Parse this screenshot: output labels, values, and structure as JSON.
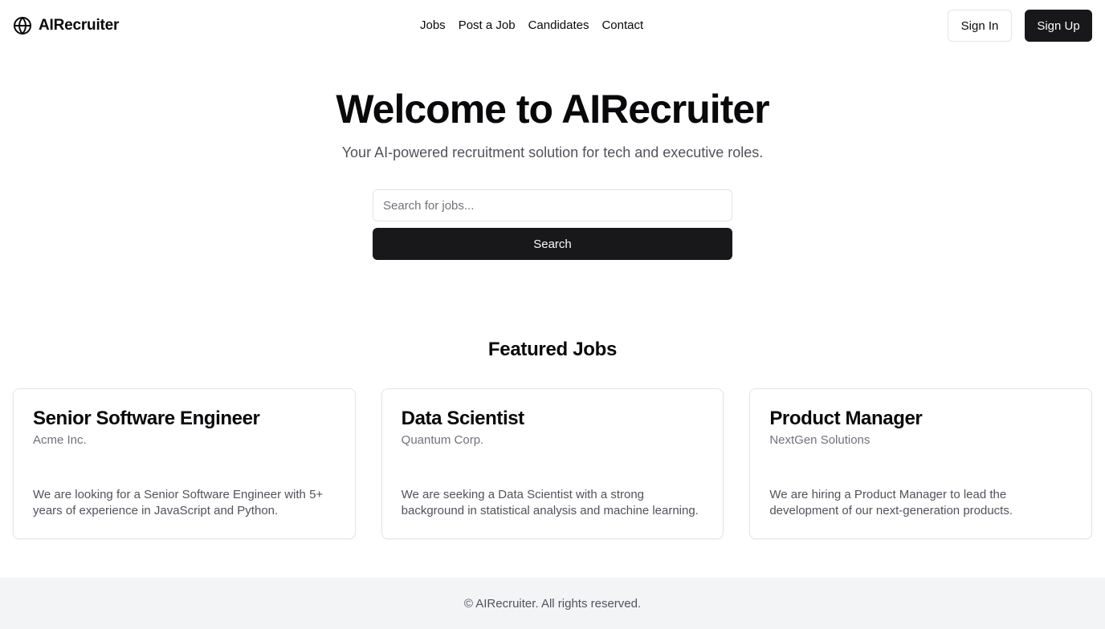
{
  "header": {
    "brand_name": "AIRecruiter",
    "brand_icon": "globe-icon",
    "nav": [
      {
        "label": "Jobs"
      },
      {
        "label": "Post a Job"
      },
      {
        "label": "Candidates"
      },
      {
        "label": "Contact"
      }
    ],
    "sign_in_label": "Sign In",
    "sign_up_label": "Sign Up"
  },
  "hero": {
    "title": "Welcome to AIRecruiter",
    "subtitle": "Your AI-powered recruitment solution for tech and executive roles.",
    "search": {
      "value": "",
      "placeholder": "Search for jobs...",
      "button_label": "Search"
    }
  },
  "featured": {
    "title": "Featured Jobs",
    "jobs": [
      {
        "title": "Senior Software Engineer",
        "company": "Acme Inc.",
        "description": "We are looking for a Senior Software Engineer with 5+ years of experience in JavaScript and Python."
      },
      {
        "title": "Data Scientist",
        "company": "Quantum Corp.",
        "description": "We are seeking a Data Scientist with a strong background in statistical analysis and machine learning."
      },
      {
        "title": "Product Manager",
        "company": "NextGen Solutions",
        "description": "We are hiring a Product Manager to lead the development of our next-generation products."
      }
    ]
  },
  "footer": {
    "text": "© AIRecruiter. All rights reserved."
  },
  "colors": {
    "primary": "#18181b",
    "text": "#09090b",
    "muted": "#71717a",
    "border": "#e4e4e7",
    "footer_bg": "#f3f4f6"
  }
}
